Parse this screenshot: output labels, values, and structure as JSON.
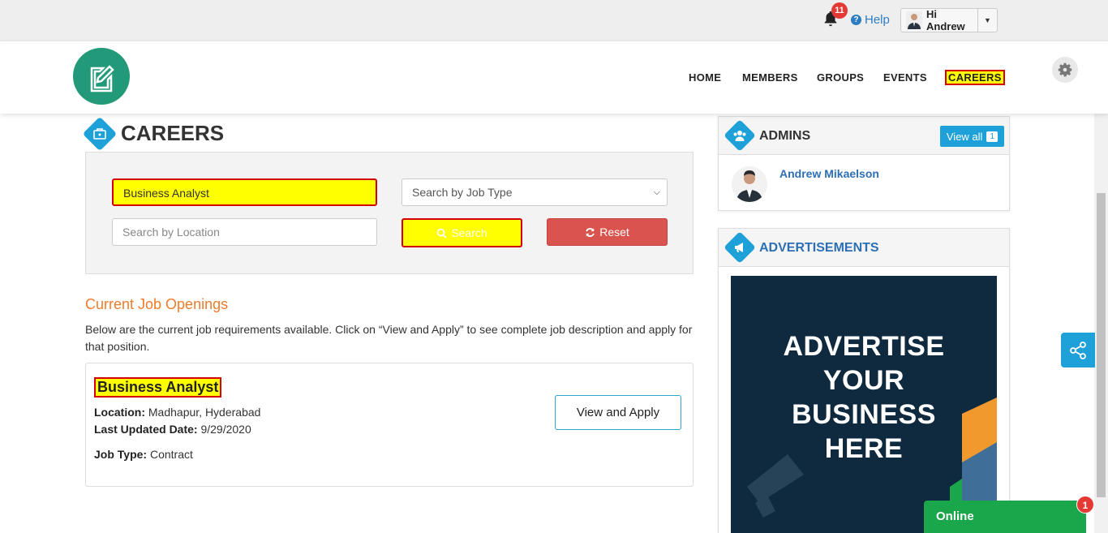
{
  "topbar": {
    "notification_count": "11",
    "help_label": "Help",
    "user_greeting": "Hi Andrew"
  },
  "nav": {
    "items": [
      "HOME",
      "MEMBERS",
      "GROUPS",
      "EVENTS",
      "CAREERS"
    ],
    "active": "CAREERS"
  },
  "page": {
    "title": "CAREERS"
  },
  "search": {
    "keyword_value": "Business Analyst",
    "job_type_placeholder": "Search by Job Type",
    "location_placeholder": "Search by Location",
    "search_label": "Search",
    "reset_label": "Reset"
  },
  "openings": {
    "title": "Current Job Openings",
    "description": "Below are the current job requirements available. Click on “View and Apply” to see complete job description and apply for that position."
  },
  "job": {
    "title": "Business Analyst",
    "location_label": "Location:",
    "location_value": "Madhapur, Hyderabad",
    "updated_label": "Last Updated Date:",
    "updated_value": "9/29/2020",
    "type_label": "Job Type:",
    "type_value": "Contract",
    "apply_label": "View and Apply"
  },
  "sidebar": {
    "admins_title": "ADMINS",
    "view_all_label": "View all",
    "view_all_count": "1",
    "admin_name": "Andrew Mikaelson",
    "ads_title": "ADVERTISEMENTS",
    "ad_text": [
      "ADVERTISE",
      "YOUR",
      "BUSINESS",
      "HERE"
    ]
  },
  "chat": {
    "status_label": "Online",
    "badge_count": "1"
  },
  "colors": {
    "accent_blue": "#1ea1d9",
    "logo_green": "#229978",
    "highlight_yellow": "#ffff00",
    "highlight_border": "#d40000",
    "reset_red": "#d9534f",
    "orange_heading": "#f07b2b",
    "online_green": "#1aa64a"
  }
}
